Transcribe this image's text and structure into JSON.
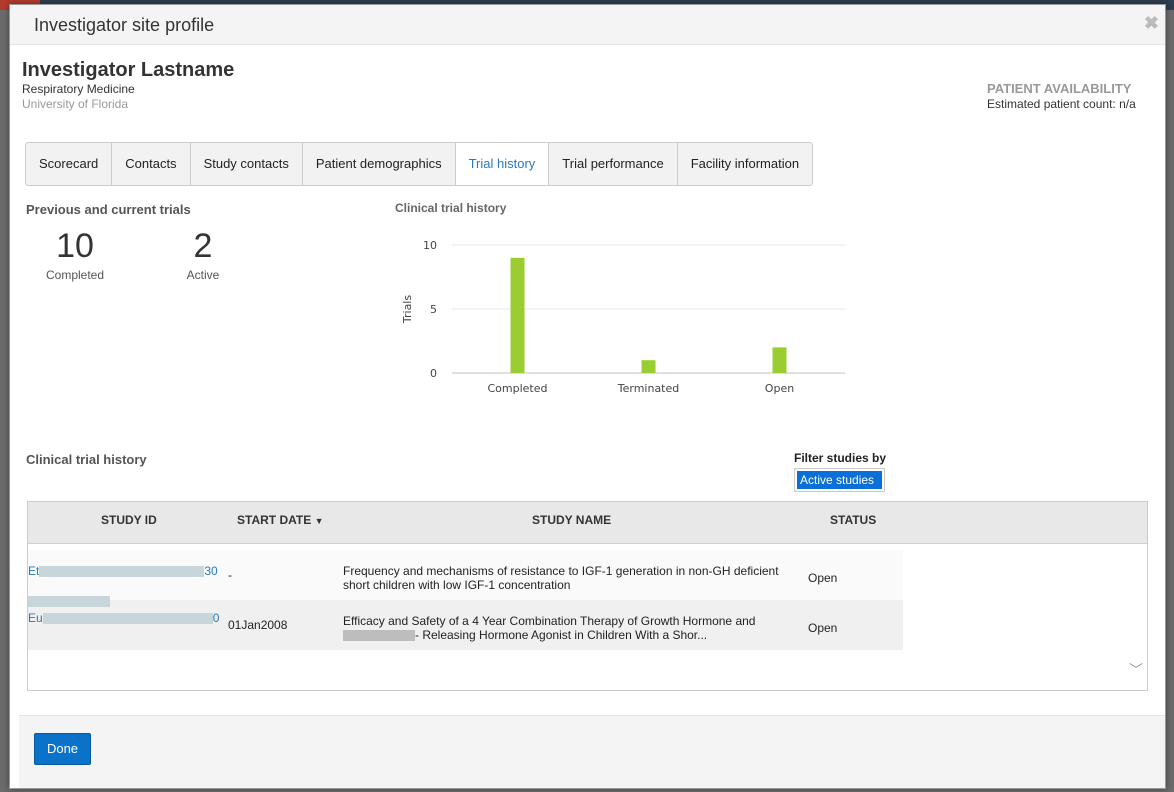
{
  "modal": {
    "title": "Investigator site profile"
  },
  "investigator": {
    "name": "Investigator Lastname",
    "department": "Respiratory Medicine",
    "university": "University of Florida"
  },
  "patient_availability": {
    "title": "PATIENT AVAILABILITY",
    "count_text": "Estimated patient count: n/a"
  },
  "tabs": [
    {
      "label": "Scorecard",
      "active": false
    },
    {
      "label": "Contacts",
      "active": false
    },
    {
      "label": "Study contacts",
      "active": false
    },
    {
      "label": "Patient demographics",
      "active": false
    },
    {
      "label": "Trial history",
      "active": true
    },
    {
      "label": "Trial performance",
      "active": false
    },
    {
      "label": "Facility information",
      "active": false
    }
  ],
  "trials_summary": {
    "title": "Previous and current trials",
    "completed": {
      "value": "10",
      "label": "Completed"
    },
    "active": {
      "value": "2",
      "label": "Active"
    }
  },
  "chart_title": "Clinical trial history",
  "chart_data": {
    "type": "bar",
    "title": "Clinical trial history",
    "categories": [
      "Completed",
      "Terminated",
      "Open"
    ],
    "values": [
      9,
      1,
      2
    ],
    "xlabel": "",
    "ylabel": "Trials",
    "ylim": [
      0,
      10
    ],
    "yticks": [
      0,
      5,
      10
    ],
    "grid": true,
    "bar_color": "#9acd32"
  },
  "table_section": {
    "title": "Clinical trial history",
    "filter_label": "Filter studies by",
    "filter_value": "Active studies"
  },
  "table": {
    "headers": {
      "study_id": "STUDY ID",
      "start_date": "START DATE",
      "study_name": "STUDY NAME",
      "status": "STATUS"
    },
    "rows": [
      {
        "id_prefix": "Et",
        "id_suffix": "30",
        "start_date": "-",
        "name_line1": "Frequency and mechanisms of resistance to IGF-1 generation in non-GH deficient",
        "name_line2": "short children with low IGF-1 concentration",
        "status": "Open"
      },
      {
        "id_prefix": "Eu",
        "id_suffix": "0",
        "start_date": "01Jan2008",
        "name_line1": "Efficacy and Safety of a 4 Year Combination Therapy of Growth Hormone and",
        "name_line2": "- Releasing Hormone Agonist in Children With a Shor...",
        "status": "Open"
      }
    ]
  },
  "footer": {
    "done_label": "Done"
  },
  "colors": {
    "accent": "#0a73c9",
    "active_tab": "#2a7ab8",
    "bar": "#9acd32"
  }
}
